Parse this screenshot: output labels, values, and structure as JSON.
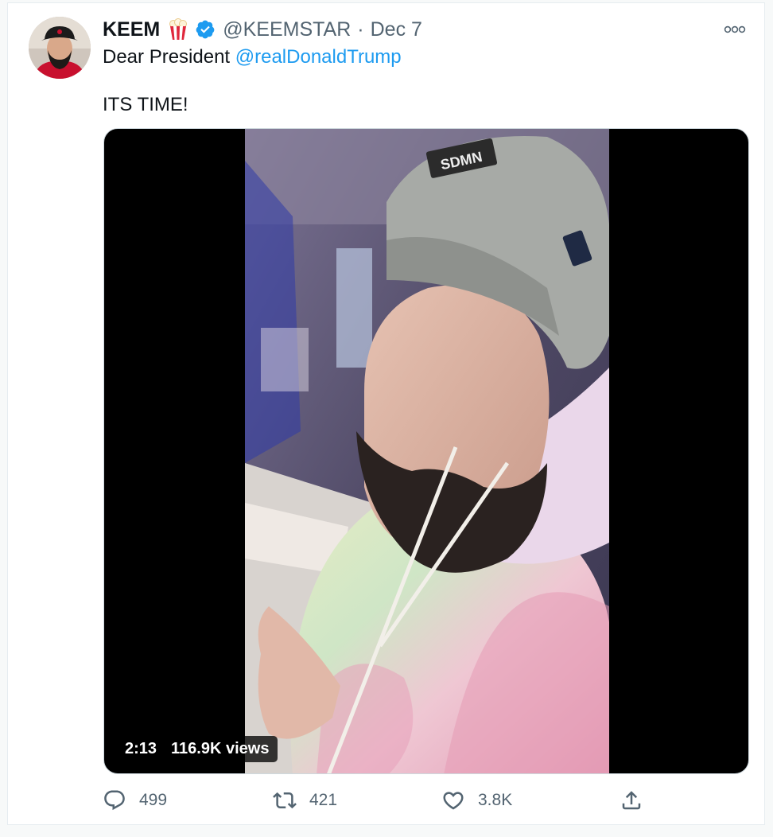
{
  "tweet": {
    "author_name": "KEEM",
    "author_emoji": "popcorn-emoji",
    "verified": true,
    "handle": "@KEEMSTAR",
    "separator": "·",
    "date": "Dec 7",
    "text_prefix": "Dear President ",
    "mention": "@realDonaldTrump",
    "text_line2": "ITS TIME!"
  },
  "media": {
    "duration": "2:13",
    "views": "116.9K views"
  },
  "actions": {
    "reply_count": "499",
    "retweet_count": "421",
    "like_count": "3.8K"
  },
  "icons": {
    "more": "more-horizontal-icon",
    "reply": "reply-icon",
    "retweet": "retweet-icon",
    "like": "heart-icon",
    "share": "share-icon",
    "verified": "verified-badge-icon"
  },
  "colors": {
    "accent": "#1d9bf0",
    "secondary_text": "#536471",
    "primary_text": "#0f1419"
  }
}
